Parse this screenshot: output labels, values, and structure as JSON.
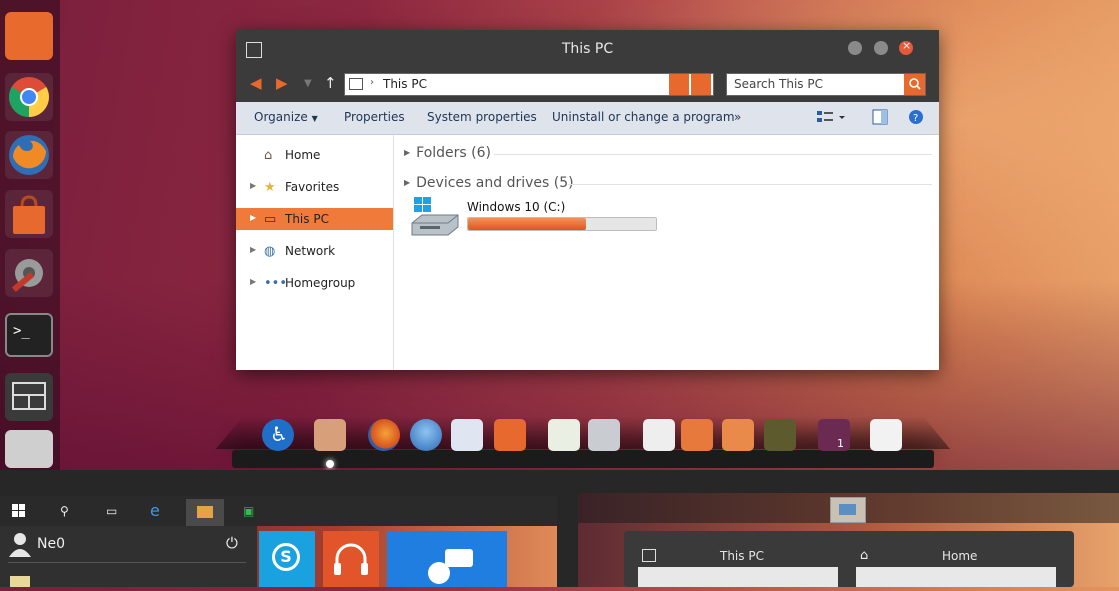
{
  "window": {
    "title": "This PC",
    "address_path": "This PC",
    "search_placeholder": "Search This PC"
  },
  "toolbar": {
    "organize": "Organize",
    "properties": "Properties",
    "system_properties": "System properties",
    "uninstall": "Uninstall or change a program",
    "more": "»"
  },
  "nav": {
    "items": [
      {
        "label": "Home",
        "icon": "home-icon"
      },
      {
        "label": "Favorites",
        "icon": "star-icon"
      },
      {
        "label": "This PC",
        "icon": "computer-icon",
        "selected": true
      },
      {
        "label": "Network",
        "icon": "network-icon"
      },
      {
        "label": "Homegroup",
        "icon": "homegroup-icon"
      }
    ]
  },
  "content": {
    "groups": [
      {
        "label": "Folders (6)"
      },
      {
        "label": "Devices and drives (5)"
      }
    ],
    "drive": {
      "name": "Windows 10 (C:)",
      "used_fraction": 0.63
    }
  },
  "dock": {
    "badge": "1"
  },
  "start_menu": {
    "user_name": "Ne0"
  },
  "task_view": {
    "windows": [
      {
        "title": "This PC"
      },
      {
        "title": "Home"
      }
    ]
  },
  "colors": {
    "accent": "#e8692d",
    "titlebar": "#3b3b3b",
    "selection": "#f07a3a"
  }
}
